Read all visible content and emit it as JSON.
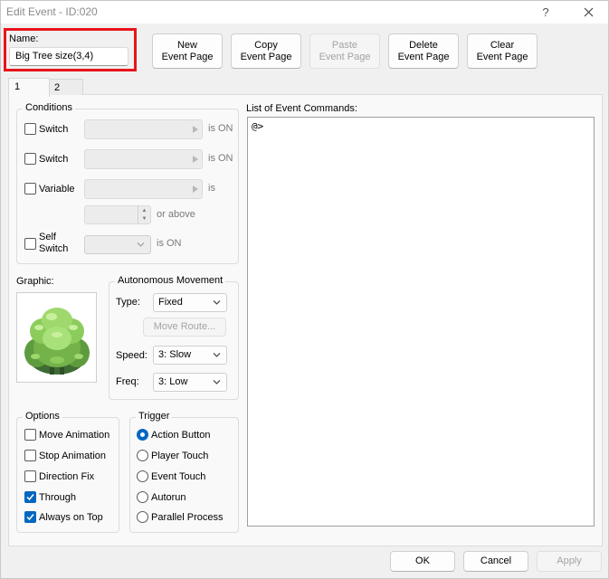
{
  "window": {
    "title": "Edit Event - ID:020",
    "help_glyph": "?"
  },
  "name": {
    "label": "Name:",
    "value": "Big Tree size(3,4)"
  },
  "page_buttons": [
    {
      "line1": "New",
      "line2": "Event Page",
      "enabled": true
    },
    {
      "line1": "Copy",
      "line2": "Event Page",
      "enabled": true
    },
    {
      "line1": "Paste",
      "line2": "Event Page",
      "enabled": false
    },
    {
      "line1": "Delete",
      "line2": "Event Page",
      "enabled": true
    },
    {
      "line1": "Clear",
      "line2": "Event Page",
      "enabled": true
    }
  ],
  "tabs": [
    {
      "label": "1",
      "selected": true
    },
    {
      "label": "2",
      "selected": false
    }
  ],
  "conditions": {
    "title": "Conditions",
    "switch1": {
      "label": "Switch",
      "suffix": "is ON",
      "checked": false
    },
    "switch2": {
      "label": "Switch",
      "suffix": "is ON",
      "checked": false
    },
    "variable": {
      "label": "Variable",
      "suffix": "is",
      "or_above": "or above",
      "checked": false
    },
    "self_switch": {
      "label_line1": "Self",
      "label_line2": "Switch",
      "suffix": "is ON",
      "checked": false
    }
  },
  "graphic": {
    "label": "Graphic:",
    "sprite": "big-tree"
  },
  "autonomous": {
    "title": "Autonomous Movement",
    "type_label": "Type:",
    "type_value": "Fixed",
    "move_route": "Move Route...",
    "speed_label": "Speed:",
    "speed_value": "3: Slow",
    "freq_label": "Freq:",
    "freq_value": "3: Low"
  },
  "options": {
    "title": "Options",
    "items": [
      {
        "label": "Move Animation",
        "checked": false
      },
      {
        "label": "Stop Animation",
        "checked": false
      },
      {
        "label": "Direction Fix",
        "checked": false
      },
      {
        "label": "Through",
        "checked": true
      },
      {
        "label": "Always on Top",
        "checked": true
      }
    ]
  },
  "trigger": {
    "title": "Trigger",
    "items": [
      {
        "label": "Action Button",
        "selected": true
      },
      {
        "label": "Player Touch",
        "selected": false
      },
      {
        "label": "Event Touch",
        "selected": false
      },
      {
        "label": "Autorun",
        "selected": false
      },
      {
        "label": "Parallel Process",
        "selected": false
      }
    ]
  },
  "commands": {
    "title": "List of Event Commands:",
    "lines": [
      "@>"
    ]
  },
  "footer": {
    "ok": "OK",
    "cancel": "Cancel",
    "apply": "Apply"
  },
  "colors": {
    "highlight_frame": "#e8141c",
    "accent": "#0067c0"
  }
}
